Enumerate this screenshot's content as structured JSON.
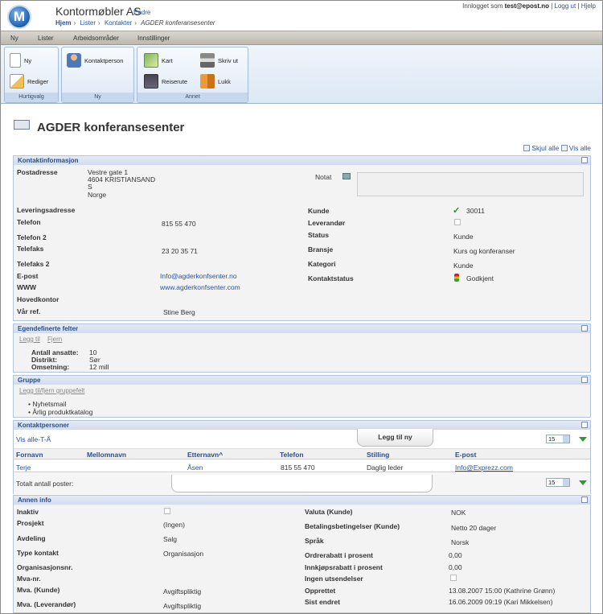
{
  "header": {
    "logo_letter": "M",
    "company": "Kontormøbler AS",
    "edit_link": "Endre",
    "breadcrumb": [
      "Hjem",
      "Lister",
      "Kontakter",
      "AGDER konferansesenter"
    ],
    "logged_in_prefix": "Innlogget som",
    "user": "test@epost.no",
    "logout": "Logg ut",
    "help": "Hjelp"
  },
  "menu": [
    "Ny",
    "Lister",
    "Arbeidsområder",
    "Innstillinger"
  ],
  "ribbon": {
    "groups": [
      {
        "title": "Hurtigvalg",
        "buttons": [
          "Ny",
          "Rediger"
        ]
      },
      {
        "title": "Ny",
        "buttons": [
          "Kontaktperson"
        ]
      },
      {
        "title": "Annet",
        "buttons": [
          "Kart",
          "Skriv ut",
          "Reiserute",
          "Lukk"
        ]
      }
    ]
  },
  "page": {
    "title": "AGDER konferansesenter",
    "hide_all": "Skjul alle",
    "show_all": "Vis alle"
  },
  "contact_info": {
    "title": "Kontaktinformasjon",
    "postadresse_label": "Postadresse",
    "postadresse": [
      "Vestre gate 1",
      "4604 KRISTIANSAND",
      "S",
      "Norge"
    ],
    "notat_label": "Notat",
    "left": [
      {
        "label": "Leveringsadresse",
        "value": ""
      },
      {
        "label": "Telefon",
        "value": "815 55 470"
      },
      {
        "label": "Telefon 2",
        "value": ""
      },
      {
        "label": "Telefaks",
        "value": "23 20 35 71"
      },
      {
        "label": "Telefaks 2",
        "value": ""
      },
      {
        "label": "E-post",
        "value": "Info@agderkonfsenter.no"
      },
      {
        "label": "WWW",
        "value": "www.agderkonfsenter.com"
      },
      {
        "label": "Hovedkontor",
        "value": ""
      },
      {
        "label": "Vår ref.",
        "value": "Stine Berg"
      }
    ],
    "right": [
      {
        "label": "Kunde",
        "value": "30011"
      },
      {
        "label": "Leverandør",
        "value": ""
      },
      {
        "label": "Status",
        "value": "Kunde"
      },
      {
        "label": "Bransje",
        "value": "Kurs og konferanser"
      },
      {
        "label": "Kategori",
        "value": "Kunde"
      },
      {
        "label": "Kontaktstatus",
        "value": "Godkjent"
      }
    ]
  },
  "custom_fields": {
    "title": "Egendefinerte felter",
    "add": "Legg til",
    "remove": "Fjern",
    "fields": [
      {
        "label": "Antall ansatte:",
        "value": "10"
      },
      {
        "label": "Distrikt:",
        "value": "Sør"
      },
      {
        "label": "Omsetning:",
        "value": "12 mill"
      }
    ]
  },
  "group": {
    "title": "Gruppe",
    "action": "Legg til/fjern gruppefelt",
    "items": [
      "Nyhetsmail",
      "Årlig produktkatalog"
    ]
  },
  "contacts": {
    "title": "Kontaktpersoner",
    "filter": "Vis alle-T-Å",
    "add_new": "Legg til ny",
    "page_size": "15",
    "columns": [
      "Fornavn",
      "Mellomnavn",
      "Etternavn^",
      "Telefon",
      "Stilling",
      "E-post"
    ],
    "rows": [
      {
        "fornavn": "Terje",
        "mellomnavn": "",
        "etternavn": "Åsen",
        "telefon": "815 55 470",
        "stilling": "Daglig leder",
        "epost": "Info@Exprezz.com"
      }
    ],
    "total_label": "Totalt antall poster:"
  },
  "other": {
    "title": "Annen info",
    "left": [
      {
        "label": "Inaktiv",
        "value": ""
      },
      {
        "label": "Prosjekt",
        "value": "(Ingen)"
      },
      {
        "label": "Avdeling",
        "value": "Salg"
      },
      {
        "label": "Type kontakt",
        "value": "Organisasjon"
      },
      {
        "label": "Organisasjonsnr.",
        "value": ""
      },
      {
        "label": "Mva-nr.",
        "value": ""
      },
      {
        "label": "Mva. (Kunde)",
        "value": "Avgiftspliktig"
      },
      {
        "label": "Mva. (Leverandør)",
        "value": "Avgiftspliktig"
      }
    ],
    "right": [
      {
        "label": "Valuta (Kunde)",
        "value": "NOK"
      },
      {
        "label": "Betalingsbetingelser (Kunde)",
        "value": "Netto 20 dager"
      },
      {
        "label": "Språk",
        "value": "Norsk"
      },
      {
        "label": "Ordrerabatt i prosent",
        "value": "0,00"
      },
      {
        "label": "Innkjøpsrabatt i prosent",
        "value": "0,00"
      },
      {
        "label": "Ingen utsendelser",
        "value": ""
      },
      {
        "label": "Opprettet",
        "value": "13.08.2007 15:00 (Kathrine Grønn)"
      },
      {
        "label": "Sist endret",
        "value": "16.06.2009 09:19 (Kari Mikkelsen)"
      }
    ]
  }
}
